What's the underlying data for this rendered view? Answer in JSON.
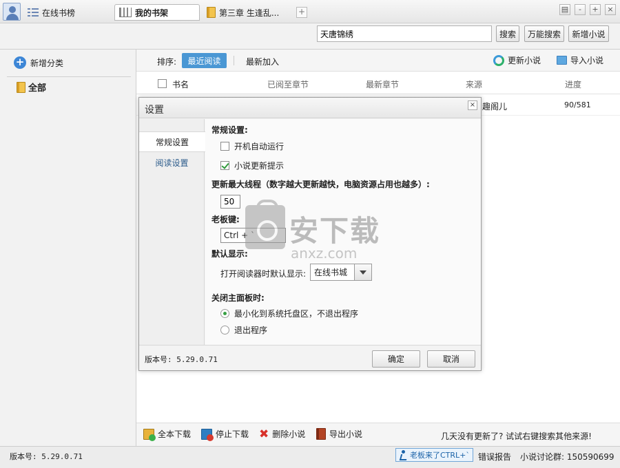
{
  "tabs": [
    {
      "label": "在线书榜",
      "icon": "list-icon"
    },
    {
      "label": "我的书架",
      "icon": "bookshelf-icon",
      "active": true
    },
    {
      "label": "第三章 生逢乱...",
      "icon": "book-icon"
    }
  ],
  "add_tab_label": "+",
  "window_controls": {
    "skin": "▤",
    "minimize": "-",
    "restore": "+",
    "close": "×"
  },
  "search": {
    "value": "天唐锦绣",
    "search_label": "搜索",
    "universal_search_label": "万能搜索",
    "add_novel_label": "新增小说"
  },
  "sidebar": {
    "add_category_label": "新增分类",
    "all_label": "全部"
  },
  "sortbar": {
    "label": "排序:",
    "recent_label": "最近阅读",
    "newest_label": "最新加入",
    "update_label": "更新小说",
    "import_label": "导入小说"
  },
  "table": {
    "headers": {
      "name": "书名",
      "read_to": "已阅至章节",
      "latest": "最新章节",
      "source": "来源",
      "progress": "进度"
    },
    "rows": [
      {
        "source": "趣阁儿",
        "progress": "90/581"
      }
    ]
  },
  "dialog": {
    "title": "设置",
    "close_label": "×",
    "nav": [
      "常规设置",
      "阅读设置"
    ],
    "general_heading": "常规设置:",
    "autostart_label": "开机自动运行",
    "update_hint_label": "小说更新提示",
    "threads_heading": "更新最大线程（数字越大更新越快，电脑资源占用也越多）:",
    "threads_value": "50",
    "boss_key_heading": "老板键:",
    "boss_key_value": "Ctrl + `",
    "default_display_heading": "默认显示:",
    "default_display_label": "打开阅读器时默认显示:",
    "default_display_value": "在线书城",
    "close_panel_heading": "关闭主面板时:",
    "minimize_label": "最小化到系统托盘区，不退出程序",
    "exit_label": "退出程序",
    "version": "版本号: 5.29.0.71",
    "ok_label": "确定",
    "cancel_label": "取消"
  },
  "bottombar": {
    "download_all": "全本下载",
    "stop_download": "停止下载",
    "delete_novel": "删除小说",
    "export_novel": "导出小说",
    "hint": "几天没有更新了? 试试右键搜索其他来源!"
  },
  "statusbar": {
    "version": "版本号: 5.29.0.71",
    "boss_button": "老板来了CTRL+`",
    "error_report": "错误报告",
    "forum": "小说讨论群: 150590699"
  },
  "watermark": {
    "cn": "安下载",
    "en": "anxz.com"
  }
}
